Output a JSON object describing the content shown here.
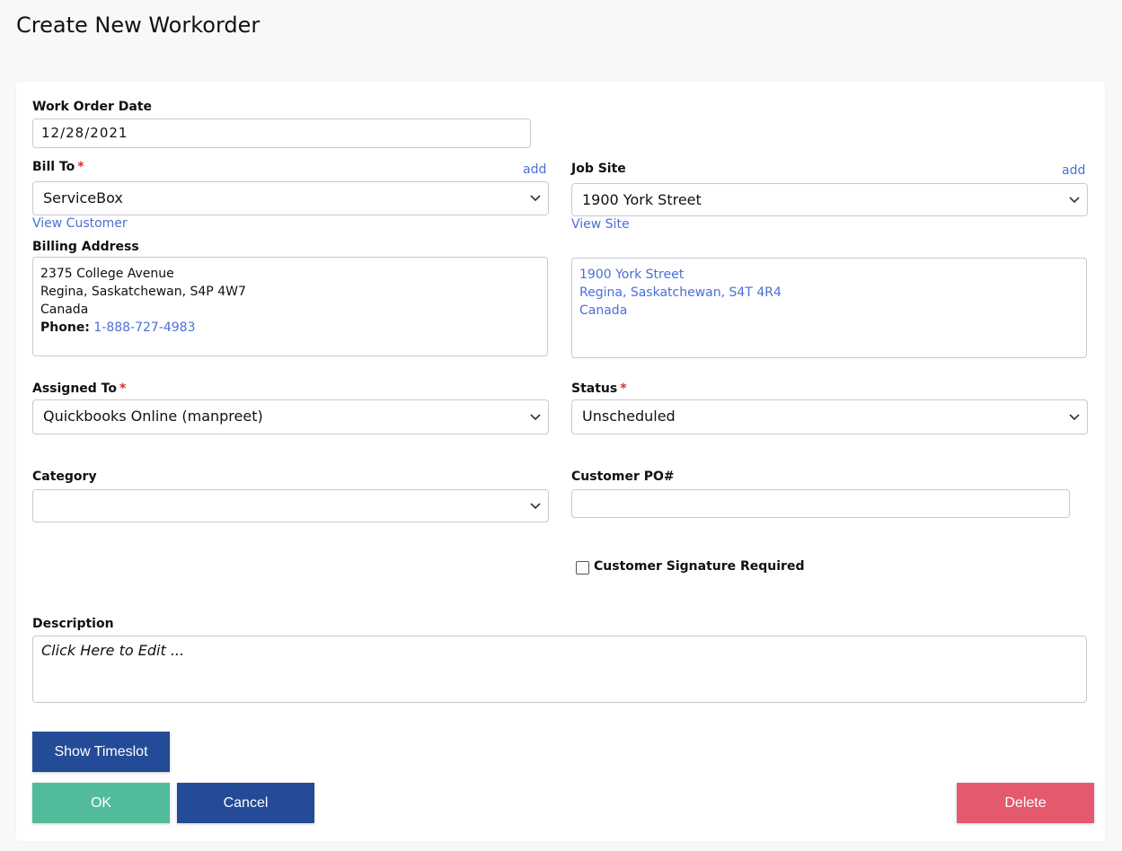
{
  "page": {
    "title": "Create New Workorder"
  },
  "work_order_date": {
    "label": "Work Order Date",
    "value": "12/28/2021"
  },
  "bill_to": {
    "label": "Bill To",
    "required_mark": "*",
    "add_link": "add",
    "selected": "ServiceBox",
    "view_link": "View Customer"
  },
  "job_site": {
    "label": "Job Site",
    "add_link": "add",
    "selected": "1900 York Street",
    "view_link": "View Site"
  },
  "billing_address": {
    "label": "Billing Address",
    "line1": "2375 College Avenue",
    "line2": "Regina, Saskatchewan, S4P 4W7",
    "line3": "Canada",
    "phone_label": "Phone:",
    "phone": "1-888-727-4983"
  },
  "site_address": {
    "line1": "1900 York Street",
    "line2": "Regina, Saskatchewan, S4T 4R4",
    "line3": "Canada"
  },
  "assigned_to": {
    "label": "Assigned To",
    "required_mark": "*",
    "selected": "Quickbooks Online (manpreet)"
  },
  "status": {
    "label": "Status",
    "required_mark": "*",
    "selected": "Unscheduled"
  },
  "category": {
    "label": "Category",
    "selected": ""
  },
  "customer_po": {
    "label": "Customer PO#",
    "value": ""
  },
  "signature": {
    "label": "Customer Signature Required",
    "checked": false
  },
  "description": {
    "label": "Description",
    "placeholder": "Click Here to Edit ..."
  },
  "buttons": {
    "show_timeslot": "Show Timeslot",
    "ok": "OK",
    "cancel": "Cancel",
    "delete": "Delete"
  },
  "colors": {
    "link": "#4a6fd6",
    "required": "#d0312d",
    "primary": "#244b97",
    "ok": "#52bb9b",
    "delete": "#e35a6f"
  }
}
